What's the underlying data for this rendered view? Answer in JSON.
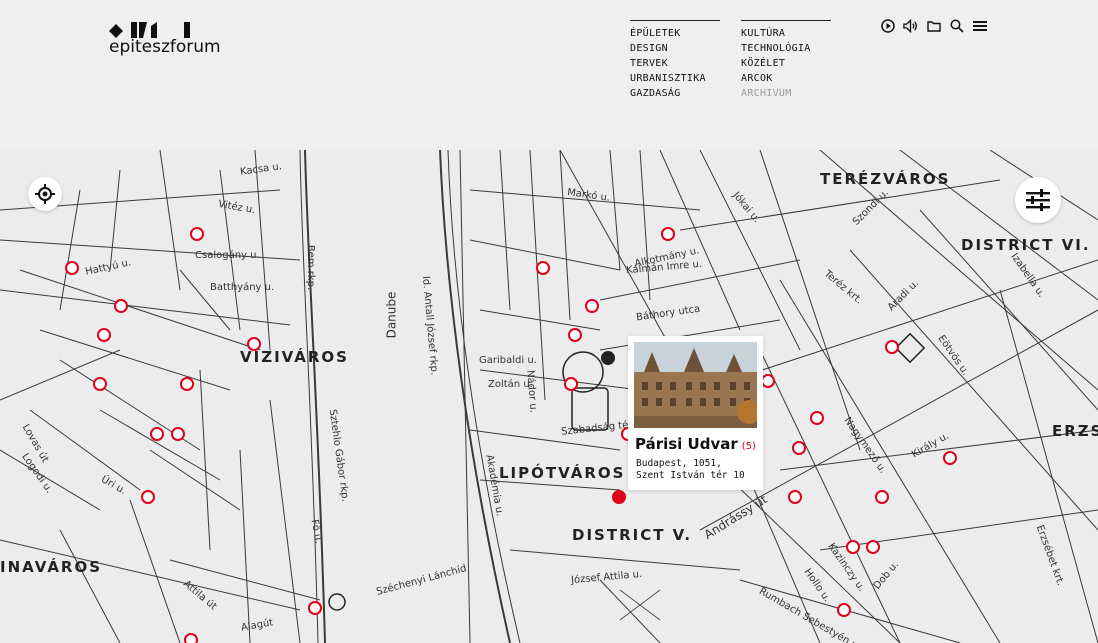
{
  "brand": {
    "logo_text": "epiteszforum"
  },
  "nav": {
    "col1": [
      "ÉPÜLETEK",
      "DESIGN",
      "TERVEK",
      "URBANISZTIKA",
      "GAZDASÁG"
    ],
    "col2": [
      "KULTÚRA",
      "TECHNOLÓGIA",
      "KÖZÉLET",
      "ARCOK",
      "ARCHIVUM"
    ]
  },
  "header_icons": [
    "play-circle-icon",
    "volume-icon",
    "folder-icon",
    "search-icon",
    "menu-icon"
  ],
  "map": {
    "districts": [
      "TERÉZVÁROS",
      "DISTRICT VI.",
      "VÍZIVÁROS",
      "LIPÓTVÁROS",
      "DISTRICT V.",
      "INAVÁROS",
      "ERZS"
    ],
    "streets": [
      "Hattyú u.",
      "Csalogány u.",
      "Batthyány u.",
      "Danube",
      "Id. Antall József rkp.",
      "Garibaldi u.",
      "Zoltán u.",
      "Nádor u.",
      "Szabadság tér",
      "Akadémia u.",
      "József Attila u.",
      "Széchenyi Lánchíd",
      "Alagút",
      "Andrássy út",
      "Teréz krt.",
      "Király u.",
      "Nagymező u.",
      "Kálmán Imre u.",
      "Alkotmány u.",
      "Báthory utca",
      "Bem rkp.",
      "Fő u.",
      "Sztehlo Gábor rkp.",
      "Attila út",
      "Vitéz u.",
      "Kacsa u.",
      "Markó u.",
      "Jókai u.",
      "Szondi u.",
      "Aradi u.",
      "Eötvös u.",
      "Izabella u.",
      "Erzsébet krt.",
      "Dob u.",
      "Kazinczy u.",
      "Rumbach Sebestyén u.",
      "Hollo u.",
      "Lovas út",
      "Logodi u.",
      "Úri u."
    ],
    "accent_color": "#e0001b"
  },
  "controls": {
    "locate": "locate-icon",
    "filter": "filter-sliders-icon"
  },
  "popup": {
    "title": "Párisi Udvar",
    "count": "(5)",
    "address_line1": "Budapest, 1051,",
    "address_line2": "Szent István tér 10"
  }
}
